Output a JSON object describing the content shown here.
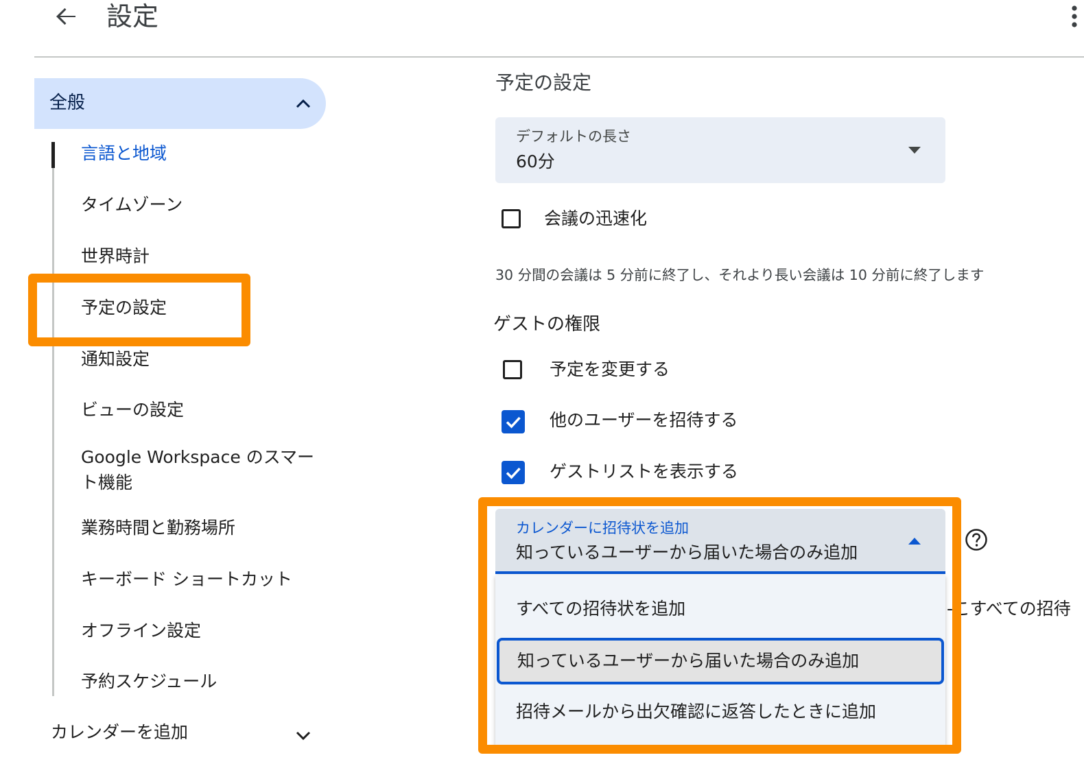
{
  "header": {
    "title": "設定",
    "back_icon": "arrow-back-icon",
    "more_icon": "more-vert-icon"
  },
  "sidebar": {
    "general": {
      "label": "全般",
      "expanded": true
    },
    "items": [
      {
        "label": "言語と地域",
        "active": true
      },
      {
        "label": "タイムゾーン"
      },
      {
        "label": "世界時計"
      },
      {
        "label": "予定の設定",
        "highlighted": true
      },
      {
        "label": "通知設定"
      },
      {
        "label": "ビューの設定"
      },
      {
        "label": "Google Workspace のスマート機能"
      },
      {
        "label": "業務時間と勤務場所"
      },
      {
        "label": "キーボード ショートカット"
      },
      {
        "label": "オフライン設定"
      },
      {
        "label": "予約スケジュール"
      }
    ],
    "add_calendar": {
      "label": "カレンダーを追加",
      "expanded": false
    }
  },
  "main": {
    "section_title": "予定の設定",
    "default_duration": {
      "label": "デフォルトの長さ",
      "value": "60分"
    },
    "speedy_meetings": {
      "label": "会議の迅速化",
      "checked": false,
      "hint": "30 分間の会議は 5 分前に終了し、それより長い会議は 10 分前に終了します"
    },
    "guest_permissions": {
      "title": "ゲストの権限",
      "options": [
        {
          "label": "予定を変更する",
          "checked": false
        },
        {
          "label": "他のユーザーを招待する",
          "checked": true
        },
        {
          "label": "ゲストリストを表示する",
          "checked": true
        }
      ]
    },
    "add_invitations": {
      "label": "カレンダーに招待状を追加",
      "value": "知っているユーザーから届いた場合のみ追加",
      "options": [
        "すべての招待状を追加",
        "知っているユーザーから届いた場合のみ追加",
        "招待メールから出欠確認に返答したときに追加"
      ],
      "selected_index": 1,
      "partially_hidden_text": "-こすべての招待"
    }
  },
  "colors": {
    "highlight": "#fb8c00",
    "accent": "#0b57d0",
    "nav_selected_bg": "#d3e3fd"
  }
}
